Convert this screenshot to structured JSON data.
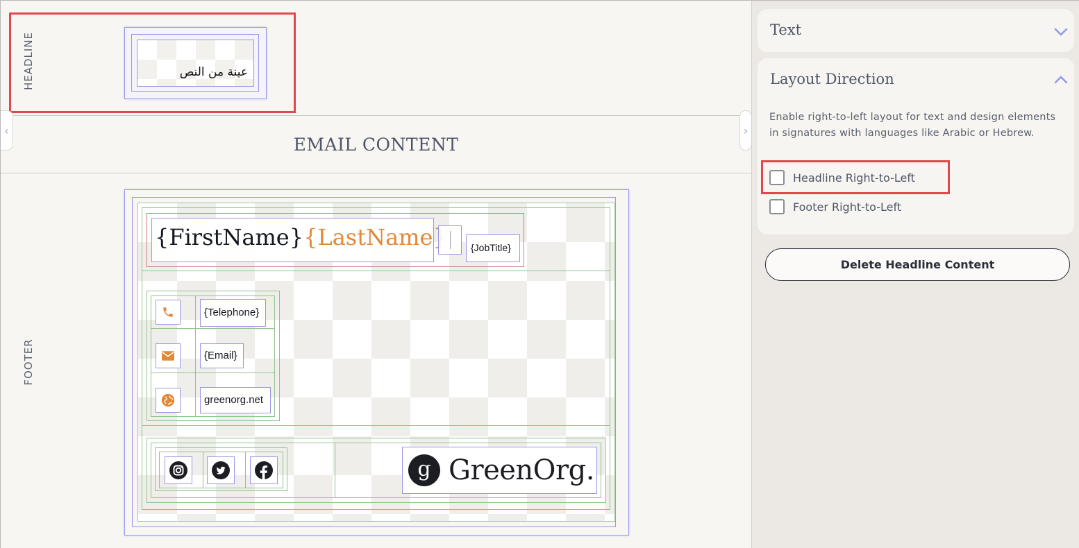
{
  "canvas": {
    "headline_label": "HEADLINE",
    "headline_text": "عينة من النص",
    "email_content_title": "EMAIL CONTENT",
    "footer_label": "FOOTER",
    "signature": {
      "first_name": "{FirstName}",
      "last_name": "{LastName}",
      "job_title": "{JobTitle}",
      "telephone": "{Telephone}",
      "email": "{Email}",
      "website": "greenorg.net",
      "logo_mark": "g",
      "logo_text": "GreenOrg."
    }
  },
  "panel": {
    "text_section": "Text",
    "layout_section": "Layout Direction",
    "layout_description": "Enable right-to-left layout for text and design elements in signatures with languages like Arabic or Hebrew.",
    "headline_rtl_label": "Headline Right-to-Left",
    "footer_rtl_label": "Footer Right-to-Left",
    "headline_rtl_checked": false,
    "footer_rtl_checked": false,
    "delete_button": "Delete Headline Content"
  },
  "colors": {
    "accent_orange": "#e0893a",
    "highlight_red": "#e0484c",
    "chevron_blue": "#8e9ae8"
  }
}
